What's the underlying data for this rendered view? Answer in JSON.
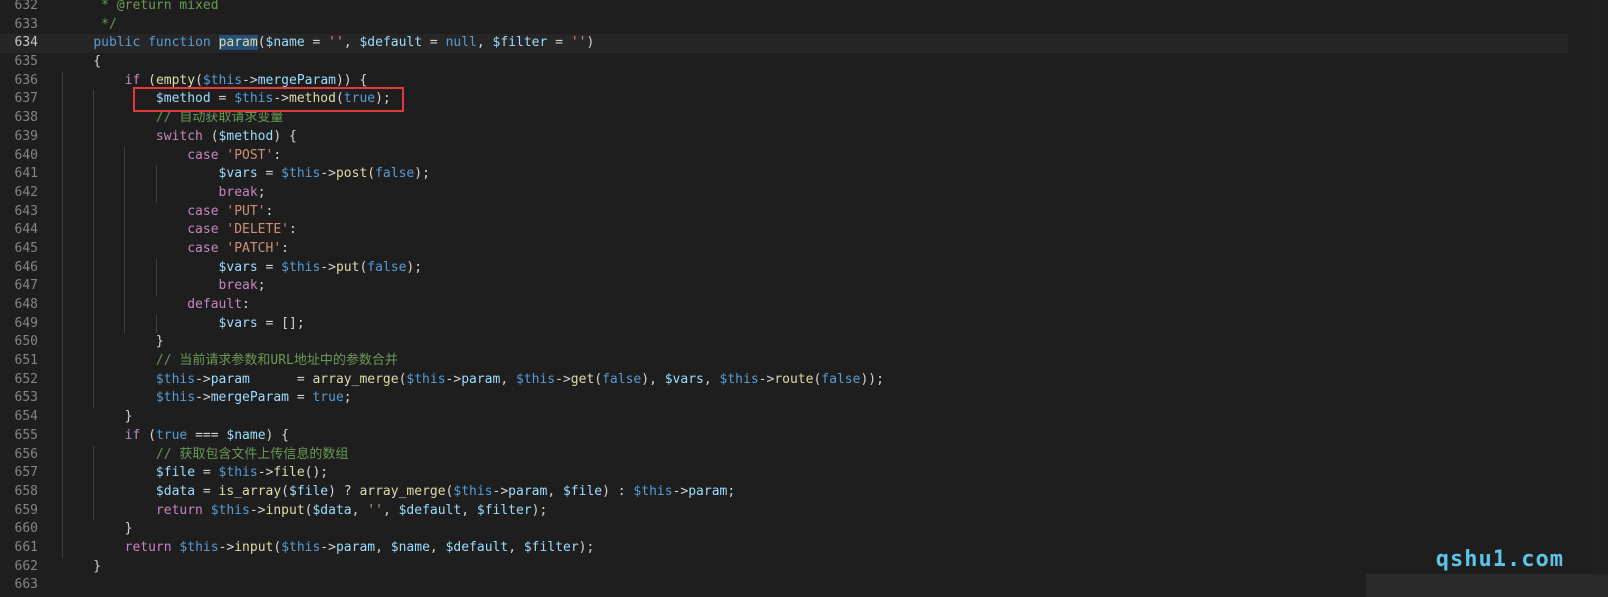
{
  "editor": {
    "lines": [
      {
        "num": "632",
        "tokens": [
          {
            "t": "     * ",
            "c": "t-cm"
          },
          {
            "t": "@return",
            "c": "t-cm"
          },
          {
            "t": " mixed",
            "c": "t-cm"
          }
        ]
      },
      {
        "num": "633",
        "tokens": [
          {
            "t": "     */",
            "c": "t-cm"
          }
        ]
      },
      {
        "num": "634",
        "current": true,
        "tokens": [
          {
            "t": "    "
          },
          {
            "t": "public",
            "c": "t-kw"
          },
          {
            "t": " "
          },
          {
            "t": "function",
            "c": "t-kw"
          },
          {
            "t": " "
          },
          {
            "t": "param",
            "c": "t-fn t-hl"
          },
          {
            "t": "("
          },
          {
            "t": "$name",
            "c": "t-var"
          },
          {
            "t": " = "
          },
          {
            "t": "''",
            "c": "t-str"
          },
          {
            "t": ", "
          },
          {
            "t": "$default",
            "c": "t-var"
          },
          {
            "t": " = "
          },
          {
            "t": "null",
            "c": "t-kw"
          },
          {
            "t": ", "
          },
          {
            "t": "$filter",
            "c": "t-var"
          },
          {
            "t": " = "
          },
          {
            "t": "''",
            "c": "t-str"
          },
          {
            "t": ")"
          }
        ]
      },
      {
        "num": "635",
        "tokens": [
          {
            "t": "    {"
          }
        ]
      },
      {
        "num": "636",
        "tokens": [
          {
            "t": "        "
          },
          {
            "t": "if",
            "c": "t-ctl"
          },
          {
            "t": " ("
          },
          {
            "t": "empty",
            "c": "t-fn"
          },
          {
            "t": "("
          },
          {
            "t": "$this",
            "c": "t-this"
          },
          {
            "t": "->"
          },
          {
            "t": "mergeParam",
            "c": "t-var"
          },
          {
            "t": ")) {"
          }
        ]
      },
      {
        "num": "637",
        "tokens": [
          {
            "t": "            "
          },
          {
            "t": "$method",
            "c": "t-var"
          },
          {
            "t": " = "
          },
          {
            "t": "$this",
            "c": "t-this"
          },
          {
            "t": "->"
          },
          {
            "t": "method",
            "c": "t-fn"
          },
          {
            "t": "("
          },
          {
            "t": "true",
            "c": "t-kw"
          },
          {
            "t": ");"
          }
        ]
      },
      {
        "num": "638",
        "tokens": [
          {
            "t": "            "
          },
          {
            "t": "// 自动获取请求变量",
            "c": "t-cm"
          }
        ]
      },
      {
        "num": "639",
        "tokens": [
          {
            "t": "            "
          },
          {
            "t": "switch",
            "c": "t-ctl"
          },
          {
            "t": " ("
          },
          {
            "t": "$method",
            "c": "t-var"
          },
          {
            "t": ") {"
          }
        ]
      },
      {
        "num": "640",
        "tokens": [
          {
            "t": "                "
          },
          {
            "t": "case",
            "c": "t-ctl"
          },
          {
            "t": " "
          },
          {
            "t": "'POST'",
            "c": "t-str"
          },
          {
            "t": ":"
          }
        ]
      },
      {
        "num": "641",
        "tokens": [
          {
            "t": "                    "
          },
          {
            "t": "$vars",
            "c": "t-var"
          },
          {
            "t": " = "
          },
          {
            "t": "$this",
            "c": "t-this"
          },
          {
            "t": "->"
          },
          {
            "t": "post",
            "c": "t-fn"
          },
          {
            "t": "("
          },
          {
            "t": "false",
            "c": "t-kw"
          },
          {
            "t": ");"
          }
        ]
      },
      {
        "num": "642",
        "tokens": [
          {
            "t": "                    "
          },
          {
            "t": "break",
            "c": "t-ctl"
          },
          {
            "t": ";"
          }
        ]
      },
      {
        "num": "643",
        "tokens": [
          {
            "t": "                "
          },
          {
            "t": "case",
            "c": "t-ctl"
          },
          {
            "t": " "
          },
          {
            "t": "'PUT'",
            "c": "t-str"
          },
          {
            "t": ":"
          }
        ]
      },
      {
        "num": "644",
        "tokens": [
          {
            "t": "                "
          },
          {
            "t": "case",
            "c": "t-ctl"
          },
          {
            "t": " "
          },
          {
            "t": "'DELETE'",
            "c": "t-str"
          },
          {
            "t": ":"
          }
        ]
      },
      {
        "num": "645",
        "tokens": [
          {
            "t": "                "
          },
          {
            "t": "case",
            "c": "t-ctl"
          },
          {
            "t": " "
          },
          {
            "t": "'PATCH'",
            "c": "t-str"
          },
          {
            "t": ":"
          }
        ]
      },
      {
        "num": "646",
        "tokens": [
          {
            "t": "                    "
          },
          {
            "t": "$vars",
            "c": "t-var"
          },
          {
            "t": " = "
          },
          {
            "t": "$this",
            "c": "t-this"
          },
          {
            "t": "->"
          },
          {
            "t": "put",
            "c": "t-fn"
          },
          {
            "t": "("
          },
          {
            "t": "false",
            "c": "t-kw"
          },
          {
            "t": ");"
          }
        ]
      },
      {
        "num": "647",
        "tokens": [
          {
            "t": "                    "
          },
          {
            "t": "break",
            "c": "t-ctl"
          },
          {
            "t": ";"
          }
        ]
      },
      {
        "num": "648",
        "tokens": [
          {
            "t": "                "
          },
          {
            "t": "default",
            "c": "t-ctl"
          },
          {
            "t": ":"
          }
        ]
      },
      {
        "num": "649",
        "tokens": [
          {
            "t": "                    "
          },
          {
            "t": "$vars",
            "c": "t-var"
          },
          {
            "t": " = [];"
          }
        ]
      },
      {
        "num": "650",
        "tokens": [
          {
            "t": "            }"
          }
        ]
      },
      {
        "num": "651",
        "tokens": [
          {
            "t": "            "
          },
          {
            "t": "// 当前请求参数和URL地址中的参数合并",
            "c": "t-cm"
          }
        ]
      },
      {
        "num": "652",
        "tokens": [
          {
            "t": "            "
          },
          {
            "t": "$this",
            "c": "t-this"
          },
          {
            "t": "->"
          },
          {
            "t": "param",
            "c": "t-var"
          },
          {
            "t": "      = "
          },
          {
            "t": "array_merge",
            "c": "t-fn"
          },
          {
            "t": "("
          },
          {
            "t": "$this",
            "c": "t-this"
          },
          {
            "t": "->"
          },
          {
            "t": "param",
            "c": "t-var"
          },
          {
            "t": ", "
          },
          {
            "t": "$this",
            "c": "t-this"
          },
          {
            "t": "->"
          },
          {
            "t": "get",
            "c": "t-fn"
          },
          {
            "t": "("
          },
          {
            "t": "false",
            "c": "t-kw"
          },
          {
            "t": "), "
          },
          {
            "t": "$vars",
            "c": "t-var"
          },
          {
            "t": ", "
          },
          {
            "t": "$this",
            "c": "t-this"
          },
          {
            "t": "->"
          },
          {
            "t": "route",
            "c": "t-fn"
          },
          {
            "t": "("
          },
          {
            "t": "false",
            "c": "t-kw"
          },
          {
            "t": "));"
          }
        ]
      },
      {
        "num": "653",
        "tokens": [
          {
            "t": "            "
          },
          {
            "t": "$this",
            "c": "t-this"
          },
          {
            "t": "->"
          },
          {
            "t": "mergeParam",
            "c": "t-var"
          },
          {
            "t": " = "
          },
          {
            "t": "true",
            "c": "t-kw"
          },
          {
            "t": ";"
          }
        ]
      },
      {
        "num": "654",
        "tokens": [
          {
            "t": "        }"
          }
        ]
      },
      {
        "num": "655",
        "tokens": [
          {
            "t": "        "
          },
          {
            "t": "if",
            "c": "t-ctl"
          },
          {
            "t": " ("
          },
          {
            "t": "true",
            "c": "t-kw"
          },
          {
            "t": " === "
          },
          {
            "t": "$name",
            "c": "t-var"
          },
          {
            "t": ") {"
          }
        ]
      },
      {
        "num": "656",
        "tokens": [
          {
            "t": "            "
          },
          {
            "t": "// 获取包含文件上传信息的数组",
            "c": "t-cm"
          }
        ]
      },
      {
        "num": "657",
        "tokens": [
          {
            "t": "            "
          },
          {
            "t": "$file",
            "c": "t-var"
          },
          {
            "t": " = "
          },
          {
            "t": "$this",
            "c": "t-this"
          },
          {
            "t": "->"
          },
          {
            "t": "file",
            "c": "t-fn"
          },
          {
            "t": "();"
          }
        ]
      },
      {
        "num": "658",
        "tokens": [
          {
            "t": "            "
          },
          {
            "t": "$data",
            "c": "t-var"
          },
          {
            "t": " = "
          },
          {
            "t": "is_array",
            "c": "t-fn"
          },
          {
            "t": "("
          },
          {
            "t": "$file",
            "c": "t-var"
          },
          {
            "t": ") ? "
          },
          {
            "t": "array_merge",
            "c": "t-fn"
          },
          {
            "t": "("
          },
          {
            "t": "$this",
            "c": "t-this"
          },
          {
            "t": "->"
          },
          {
            "t": "param",
            "c": "t-var"
          },
          {
            "t": ", "
          },
          {
            "t": "$file",
            "c": "t-var"
          },
          {
            "t": ") : "
          },
          {
            "t": "$this",
            "c": "t-this"
          },
          {
            "t": "->"
          },
          {
            "t": "param",
            "c": "t-var"
          },
          {
            "t": ";"
          }
        ]
      },
      {
        "num": "659",
        "tokens": [
          {
            "t": "            "
          },
          {
            "t": "return",
            "c": "t-ctl"
          },
          {
            "t": " "
          },
          {
            "t": "$this",
            "c": "t-this"
          },
          {
            "t": "->"
          },
          {
            "t": "input",
            "c": "t-fn"
          },
          {
            "t": "("
          },
          {
            "t": "$data",
            "c": "t-var"
          },
          {
            "t": ", "
          },
          {
            "t": "''",
            "c": "t-str"
          },
          {
            "t": ", "
          },
          {
            "t": "$default",
            "c": "t-var"
          },
          {
            "t": ", "
          },
          {
            "t": "$filter",
            "c": "t-var"
          },
          {
            "t": ");"
          }
        ]
      },
      {
        "num": "660",
        "tokens": [
          {
            "t": "        }"
          }
        ]
      },
      {
        "num": "661",
        "tokens": [
          {
            "t": "        "
          },
          {
            "t": "return",
            "c": "t-ctl"
          },
          {
            "t": " "
          },
          {
            "t": "$this",
            "c": "t-this"
          },
          {
            "t": "->"
          },
          {
            "t": "input",
            "c": "t-fn"
          },
          {
            "t": "("
          },
          {
            "t": "$this",
            "c": "t-this"
          },
          {
            "t": "->"
          },
          {
            "t": "param",
            "c": "t-var"
          },
          {
            "t": ", "
          },
          {
            "t": "$name",
            "c": "t-var"
          },
          {
            "t": ", "
          },
          {
            "t": "$default",
            "c": "t-var"
          },
          {
            "t": ", "
          },
          {
            "t": "$filter",
            "c": "t-var"
          },
          {
            "t": ");"
          }
        ]
      },
      {
        "num": "662",
        "tokens": [
          {
            "t": "    }"
          }
        ]
      },
      {
        "num": "663",
        "tokens": []
      }
    ]
  },
  "watermark": "qshu1.com",
  "colors": {
    "highlight_box": "#e03a3a",
    "background": "#1e1e1e"
  }
}
